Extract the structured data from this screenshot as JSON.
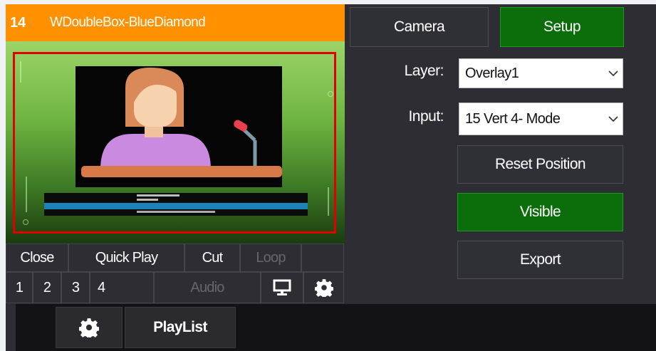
{
  "title_bar": {
    "number": "14",
    "name": "WDoubleBox-BlueDiamond"
  },
  "controls_row1": {
    "close": "Close",
    "quick_play": "Quick Play",
    "cut": "Cut",
    "loop": "Loop"
  },
  "controls_row2": {
    "n1": "1",
    "n2": "2",
    "n3": "3",
    "n4": "4",
    "audio": "Audio",
    "icons": [
      "monitor-icon",
      "gear-icon"
    ]
  },
  "right_panel": {
    "camera": "Camera",
    "setup": "Setup",
    "layer_label": "Layer:",
    "layer_value": "Overlay1",
    "input_label": "Input:",
    "input_value": "15 Vert 4- Mode",
    "reset_position": "Reset Position",
    "visible": "Visible",
    "export": "Export"
  },
  "bottom_bar": {
    "playlist": "PlayList",
    "icons": [
      "gear-icon"
    ]
  },
  "colors": {
    "title_orange": "#ff9000",
    "active_green": "#0b6e0b",
    "selection_red": "#e00000",
    "panel": "#2d2d33"
  }
}
